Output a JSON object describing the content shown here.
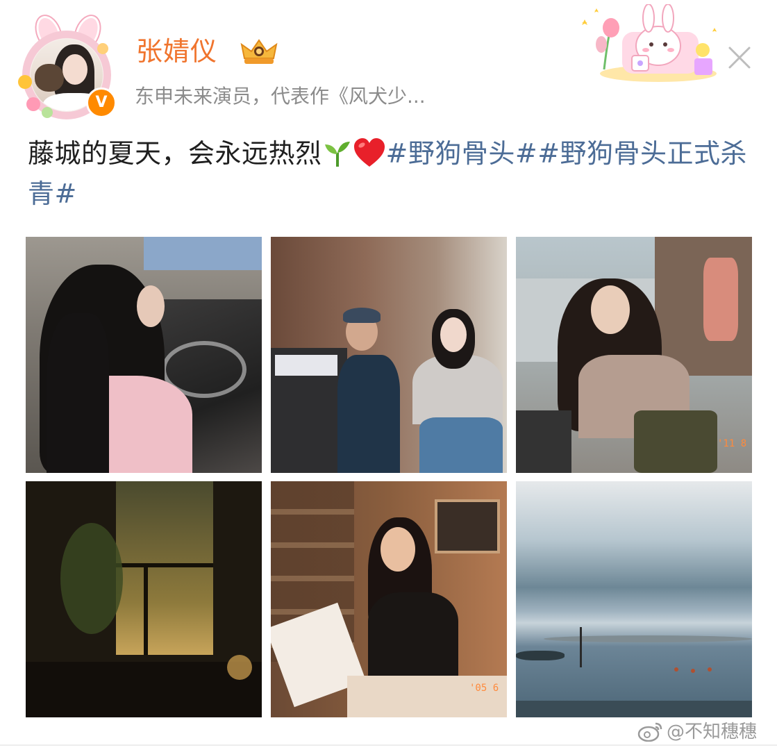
{
  "header": {
    "user_name": "张婧仪",
    "user_desc": "东申未来演员，代表作《风犬少...",
    "verified_mark": "V"
  },
  "post": {
    "text": "藤城的夏天，会永远热烈",
    "emojis": [
      "seedling-emoji",
      "red-heart-emoji"
    ],
    "hashtag_1": "#野狗骨头#",
    "hashtag_2": "#野狗骨头正式杀青#"
  },
  "photos": [
    {
      "description": "girl-with-long-hair-from-behind",
      "date_stamp": ""
    },
    {
      "description": "actress-and-director-peace-sign",
      "date_stamp": ""
    },
    {
      "description": "actress-in-folding-chair",
      "date_stamp": "'11 8"
    },
    {
      "description": "dark-window-night",
      "date_stamp": ""
    },
    {
      "description": "actress-reading-script",
      "date_stamp": "'05 6"
    },
    {
      "description": "sea-horizon-clouds",
      "date_stamp": ""
    }
  ],
  "watermark": {
    "text": "@不知穗穗"
  },
  "colors": {
    "name": "#f0742d",
    "hashtag": "#4c6c96",
    "body_text": "#1f1f1f",
    "desc_text": "#8b8b8b"
  }
}
